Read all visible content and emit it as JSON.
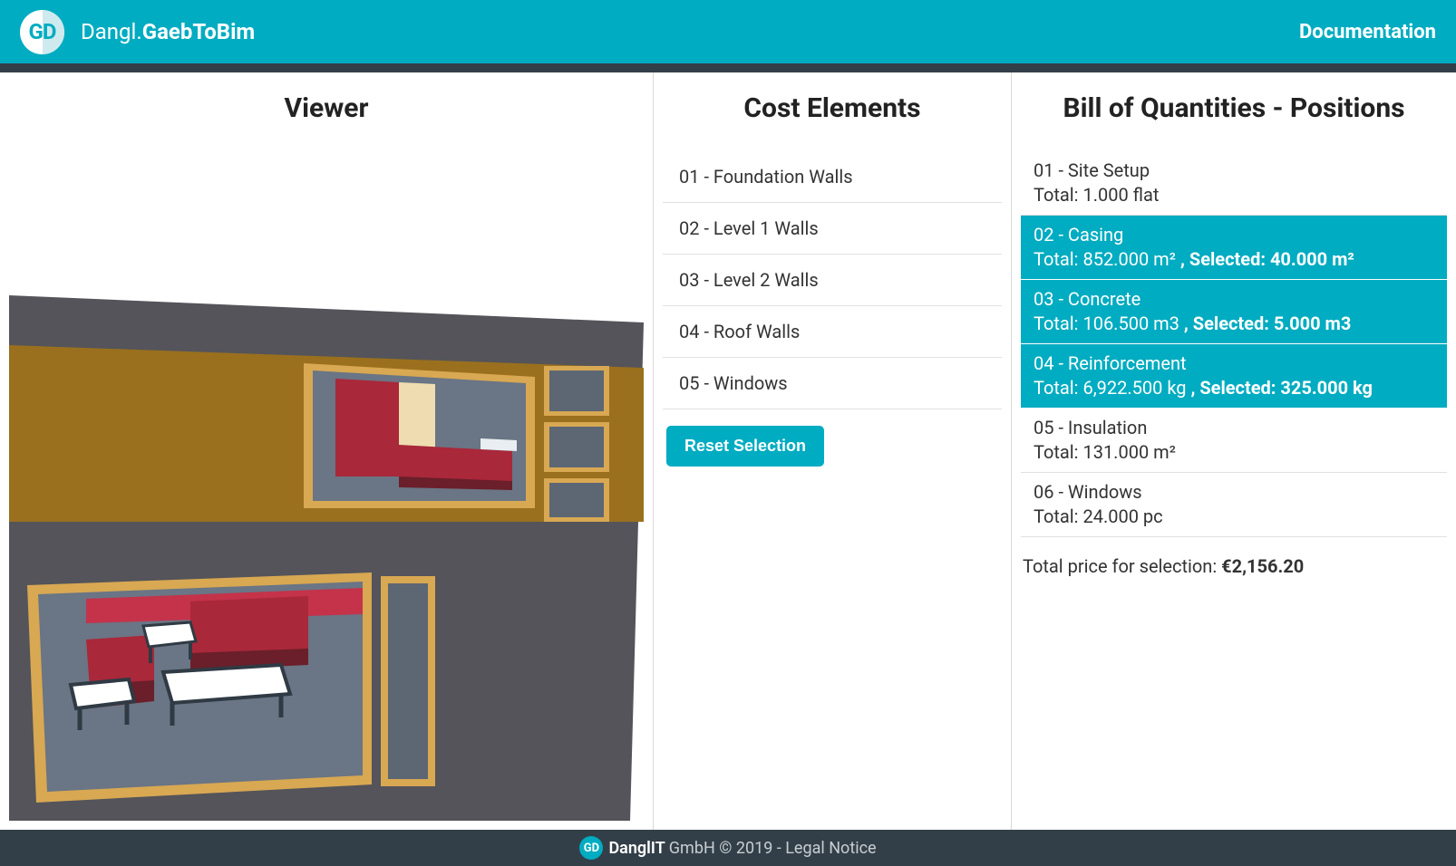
{
  "header": {
    "logo_initials": "GD",
    "brand_light": "Dangl.",
    "brand_bold": "GaebToBim",
    "doc_link": "Documentation"
  },
  "panels": {
    "viewer_title": "Viewer",
    "cost_title": "Cost Elements",
    "boq_title": "Bill of Quantities - Positions"
  },
  "cost_elements": {
    "items": [
      {
        "label": "01 - Foundation Walls"
      },
      {
        "label": "02 - Level 1 Walls"
      },
      {
        "label": "03 - Level 2 Walls"
      },
      {
        "label": "04 - Roof Walls"
      },
      {
        "label": "05 - Windows"
      }
    ],
    "reset_label": "Reset Selection"
  },
  "boq": {
    "items": [
      {
        "title": "01 - Site Setup",
        "total": "Total: 1.000 flat",
        "selected": "",
        "is_selected": false
      },
      {
        "title": "02 - Casing",
        "total": "Total: 852.000 m² ",
        "selected": ", Selected: 40.000 m²",
        "is_selected": true
      },
      {
        "title": "03 - Concrete",
        "total": "Total: 106.500 m3 ",
        "selected": ", Selected: 5.000 m3",
        "is_selected": true
      },
      {
        "title": "04 - Reinforcement",
        "total": "Total: 6,922.500 kg ",
        "selected": ", Selected: 325.000 kg",
        "is_selected": true
      },
      {
        "title": "05 - Insulation",
        "total": "Total: 131.000 m²",
        "selected": "",
        "is_selected": false
      },
      {
        "title": "06 - Windows",
        "total": "Total: 24.000 pc",
        "selected": "",
        "is_selected": false
      }
    ],
    "summary_label": "Total price for selection: ",
    "summary_value": "€2,156.20"
  },
  "footer": {
    "logo_initials": "GD",
    "company": "DanglIT",
    "rest": " GmbH © 2019 - Legal Notice"
  }
}
